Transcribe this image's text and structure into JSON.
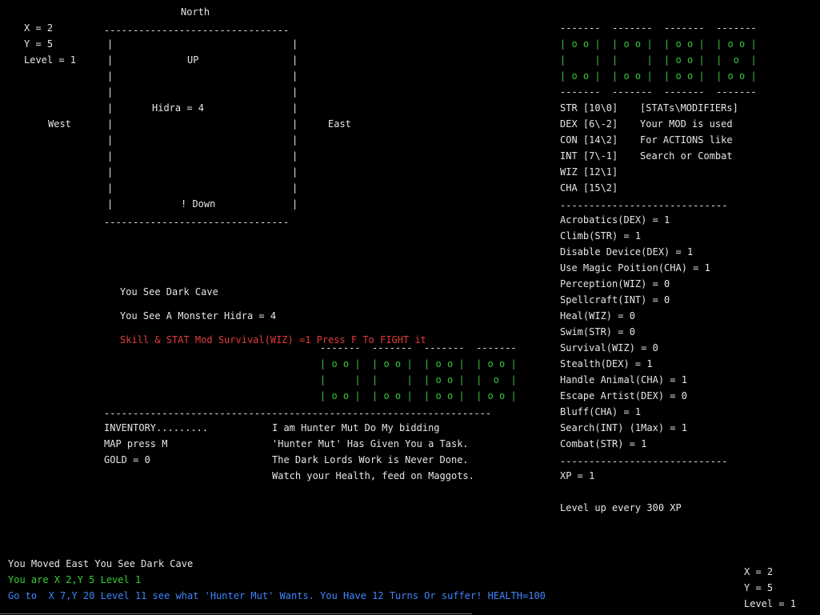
{
  "coords_top": {
    "x": "X = 2",
    "y": "Y = 5",
    "level": "Level = 1"
  },
  "compass": {
    "north": "North",
    "west": "West",
    "east": "East"
  },
  "map": {
    "top_border": "--------------------------------",
    "bottom_border": "--------------------------------",
    "wall": "|",
    "up": "UP",
    "monster": "Hidra = 4",
    "down": "! Down"
  },
  "messages": {
    "see_cave": "You See Dark Cave",
    "see_monster": "You See A Monster Hidra = 4",
    "fight_prompt": "Skill & STAT Mod Survival(WIZ) =1 Press F To FIGHT it"
  },
  "dice_top": {
    "border_top": "-------  -------  -------  -------",
    "row1": "| o o |  | o o |  | o o |  | o o |",
    "row2": "|     |  |     |  | o o |  |  o  |",
    "row3": "| o o |  | o o |  | o o |  | o o |",
    "border_bottom": "-------  -------  -------  -------"
  },
  "dice_mid": {
    "border_top": "-------  -------  -------  -------",
    "row1": "| o o |  | o o |  | o o |  | o o |",
    "row2": "|     |  |     |  | o o |  |  o  |",
    "row3": "| o o |  | o o |  | o o |  | o o |",
    "border_bottom": "-------------------------------------------------------------------"
  },
  "stats": {
    "str": "STR [10\\0]",
    "dex": "DEX [6\\-2]",
    "con": "CON [14\\2]",
    "int": "INT [7\\-1]",
    "wiz": "WIZ [12\\1]",
    "cha": "CHA [15\\2]"
  },
  "stats_note": {
    "line1": "[STATs\\MODIFIERs]",
    "line2": "Your MOD is used",
    "line3": "For ACTIONS like",
    "line4": "Search or Combat"
  },
  "skills": {
    "rule_top": "-----------------------------",
    "items": [
      "Acrobatics(DEX) = 1",
      "Climb(STR) = 1",
      "Disable Device(DEX) = 1",
      "Use Magic Poition(CHA) = 1",
      "Perception(WIZ) = 0",
      "Spellcraft(INT) = 0",
      "Heal(WIZ) = 0",
      "Swim(STR) = 0",
      "Survival(WIZ) = 0",
      "Stealth(DEX) = 1",
      "Handle Animal(CHA) = 1",
      "Escape Artist(DEX) = 0",
      "Bluff(CHA) = 1",
      "Search(INT) (1Max) = 1",
      "Combat(STR) = 1"
    ],
    "rule_bottom": "-----------------------------",
    "xp": "XP = 1",
    "level_up": "Level up every 300 XP"
  },
  "inventory": {
    "title": "INVENTORY.........",
    "map_hint": "MAP press M",
    "gold": "GOLD = 0"
  },
  "story": {
    "line1": "I am Hunter Mut Do My bidding",
    "line2": "'Hunter Mut' Has Given You a Task.",
    "line3": "The Dark Lords Work is Never Done.",
    "line4": "Watch your Health, feed on Maggots."
  },
  "log": {
    "moved": "You Moved East You See Dark Cave",
    "position": "You are X 2,Y 5 Level 1",
    "goal": "Go to  X 7,Y 20 Level 11 see what 'Hunter Mut' Wants. You Have 12 Turns Or suffer! HEALTH=100"
  },
  "coords_bottom": {
    "x": "X = 2",
    "y": "Y = 5",
    "level": "Level = 1"
  },
  "colors": {
    "background": "#000000",
    "text": "#e6e6e6",
    "green": "#34d134",
    "blue": "#3f86ff",
    "red": "#e33a3a"
  }
}
